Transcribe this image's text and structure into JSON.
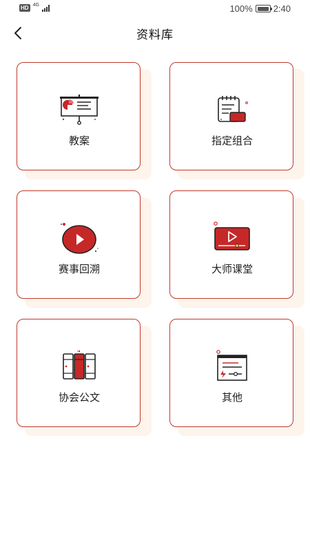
{
  "status": {
    "hd": "HD",
    "network": "4G",
    "battery": "100%",
    "time": "2:40"
  },
  "header": {
    "title": "资料库",
    "back_icon": "chevron-left-icon"
  },
  "categories": [
    {
      "label": "教案",
      "icon": "presentation-board-icon"
    },
    {
      "label": "指定组合",
      "icon": "notepad-icon"
    },
    {
      "label": "赛事回溯",
      "icon": "play-circle-icon"
    },
    {
      "label": "大师课堂",
      "icon": "video-player-icon"
    },
    {
      "label": "协会公文",
      "icon": "books-icon"
    },
    {
      "label": "其他",
      "icon": "document-frame-icon"
    }
  ],
  "colors": {
    "accent": "#c62828",
    "card_border": "#c0392b",
    "card_shadow": "#fdf4ec"
  }
}
